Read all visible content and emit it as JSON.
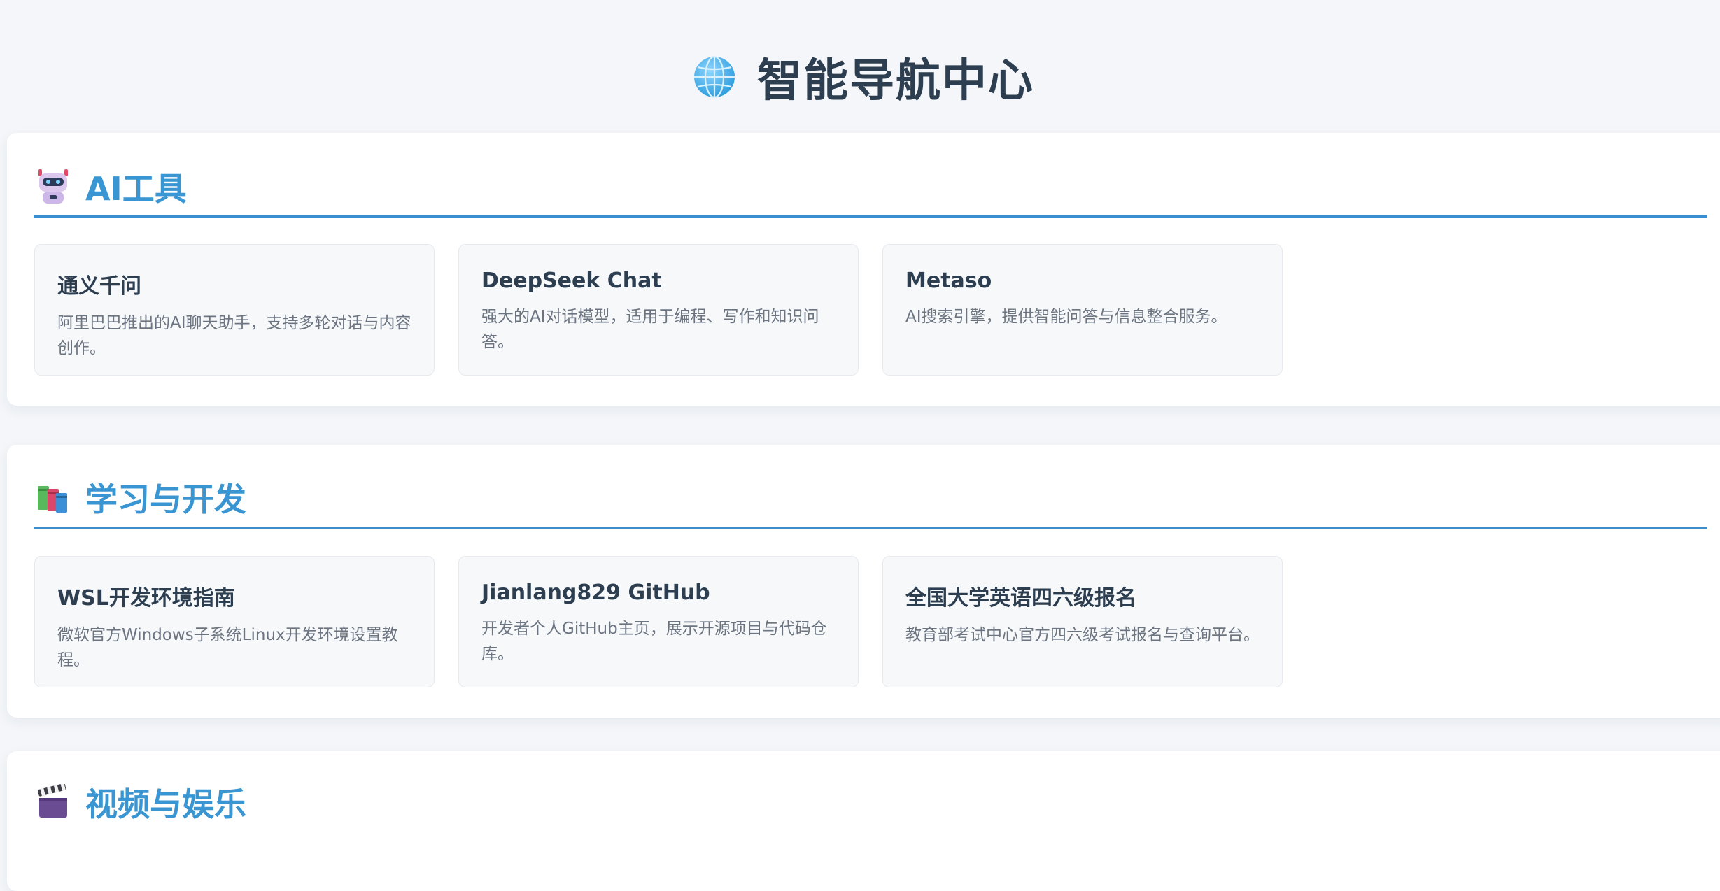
{
  "page": {
    "title": "智能导航中心",
    "title_icon": "globe-icon"
  },
  "sections": [
    {
      "title": "AI工具",
      "icon": "robot-icon",
      "cards": [
        {
          "title": "通义千问",
          "desc": "阿里巴巴推出的AI聊天助手，支持多轮对话与内容创作。"
        },
        {
          "title": "DeepSeek Chat",
          "desc": "强大的AI对话模型，适用于编程、写作和知识问答。"
        },
        {
          "title": "Metaso",
          "desc": "AI搜索引擎，提供智能问答与信息整合服务。"
        }
      ]
    },
    {
      "title": "学习与开发",
      "icon": "books-icon",
      "cards": [
        {
          "title": "WSL开发环境指南",
          "desc": "微软官方Windows子系统Linux开发环境设置教程。"
        },
        {
          "title": "Jianlang829 GitHub",
          "desc": "开发者个人GitHub主页，展示开源项目与代码仓库。"
        },
        {
          "title": "全国大学英语四六级报名",
          "desc": "教育部考试中心官方四六级考试报名与查询平台。"
        }
      ]
    },
    {
      "title": "视频与娱乐",
      "icon": "clapperboard-icon"
    }
  ],
  "colors": {
    "background": "#f4f6f9",
    "section_title": "#3a96d2",
    "section_rule": "#3a8ed0",
    "card_bg": "#f6f8fa",
    "text_primary": "#2c3e50",
    "text_secondary": "#6b7480"
  }
}
